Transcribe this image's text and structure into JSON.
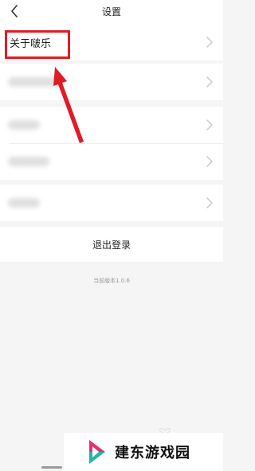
{
  "header": {
    "title": "设置",
    "back_icon": "chevron-left-icon"
  },
  "sections": {
    "about": {
      "label": "关于啵乐"
    }
  },
  "logout": {
    "label": "退出登录"
  },
  "version": {
    "text": "当前版本1.0.6"
  },
  "watermark": {
    "text": "建东游戏园"
  },
  "colors": {
    "highlight": "#e01b24",
    "background": "#f5f5f5",
    "card": "#ffffff"
  }
}
